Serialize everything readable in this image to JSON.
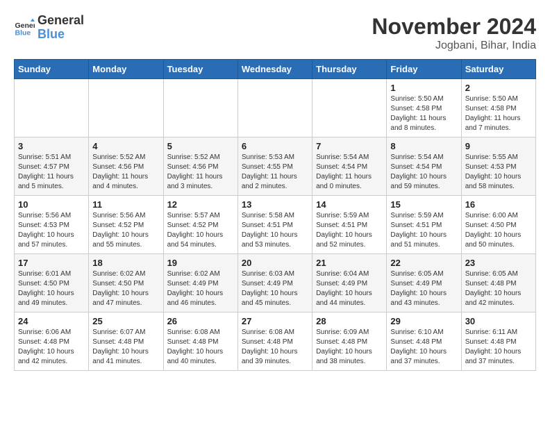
{
  "header": {
    "logo_line1": "General",
    "logo_line2": "Blue",
    "month": "November 2024",
    "location": "Jogbani, Bihar, India"
  },
  "weekdays": [
    "Sunday",
    "Monday",
    "Tuesday",
    "Wednesday",
    "Thursday",
    "Friday",
    "Saturday"
  ],
  "weeks": [
    [
      {
        "day": "",
        "info": ""
      },
      {
        "day": "",
        "info": ""
      },
      {
        "day": "",
        "info": ""
      },
      {
        "day": "",
        "info": ""
      },
      {
        "day": "",
        "info": ""
      },
      {
        "day": "1",
        "info": "Sunrise: 5:50 AM\nSunset: 4:58 PM\nDaylight: 11 hours\nand 8 minutes."
      },
      {
        "day": "2",
        "info": "Sunrise: 5:50 AM\nSunset: 4:58 PM\nDaylight: 11 hours\nand 7 minutes."
      }
    ],
    [
      {
        "day": "3",
        "info": "Sunrise: 5:51 AM\nSunset: 4:57 PM\nDaylight: 11 hours\nand 5 minutes."
      },
      {
        "day": "4",
        "info": "Sunrise: 5:52 AM\nSunset: 4:56 PM\nDaylight: 11 hours\nand 4 minutes."
      },
      {
        "day": "5",
        "info": "Sunrise: 5:52 AM\nSunset: 4:56 PM\nDaylight: 11 hours\nand 3 minutes."
      },
      {
        "day": "6",
        "info": "Sunrise: 5:53 AM\nSunset: 4:55 PM\nDaylight: 11 hours\nand 2 minutes."
      },
      {
        "day": "7",
        "info": "Sunrise: 5:54 AM\nSunset: 4:54 PM\nDaylight: 11 hours\nand 0 minutes."
      },
      {
        "day": "8",
        "info": "Sunrise: 5:54 AM\nSunset: 4:54 PM\nDaylight: 10 hours\nand 59 minutes."
      },
      {
        "day": "9",
        "info": "Sunrise: 5:55 AM\nSunset: 4:53 PM\nDaylight: 10 hours\nand 58 minutes."
      }
    ],
    [
      {
        "day": "10",
        "info": "Sunrise: 5:56 AM\nSunset: 4:53 PM\nDaylight: 10 hours\nand 57 minutes."
      },
      {
        "day": "11",
        "info": "Sunrise: 5:56 AM\nSunset: 4:52 PM\nDaylight: 10 hours\nand 55 minutes."
      },
      {
        "day": "12",
        "info": "Sunrise: 5:57 AM\nSunset: 4:52 PM\nDaylight: 10 hours\nand 54 minutes."
      },
      {
        "day": "13",
        "info": "Sunrise: 5:58 AM\nSunset: 4:51 PM\nDaylight: 10 hours\nand 53 minutes."
      },
      {
        "day": "14",
        "info": "Sunrise: 5:59 AM\nSunset: 4:51 PM\nDaylight: 10 hours\nand 52 minutes."
      },
      {
        "day": "15",
        "info": "Sunrise: 5:59 AM\nSunset: 4:51 PM\nDaylight: 10 hours\nand 51 minutes."
      },
      {
        "day": "16",
        "info": "Sunrise: 6:00 AM\nSunset: 4:50 PM\nDaylight: 10 hours\nand 50 minutes."
      }
    ],
    [
      {
        "day": "17",
        "info": "Sunrise: 6:01 AM\nSunset: 4:50 PM\nDaylight: 10 hours\nand 49 minutes."
      },
      {
        "day": "18",
        "info": "Sunrise: 6:02 AM\nSunset: 4:50 PM\nDaylight: 10 hours\nand 47 minutes."
      },
      {
        "day": "19",
        "info": "Sunrise: 6:02 AM\nSunset: 4:49 PM\nDaylight: 10 hours\nand 46 minutes."
      },
      {
        "day": "20",
        "info": "Sunrise: 6:03 AM\nSunset: 4:49 PM\nDaylight: 10 hours\nand 45 minutes."
      },
      {
        "day": "21",
        "info": "Sunrise: 6:04 AM\nSunset: 4:49 PM\nDaylight: 10 hours\nand 44 minutes."
      },
      {
        "day": "22",
        "info": "Sunrise: 6:05 AM\nSunset: 4:49 PM\nDaylight: 10 hours\nand 43 minutes."
      },
      {
        "day": "23",
        "info": "Sunrise: 6:05 AM\nSunset: 4:48 PM\nDaylight: 10 hours\nand 42 minutes."
      }
    ],
    [
      {
        "day": "24",
        "info": "Sunrise: 6:06 AM\nSunset: 4:48 PM\nDaylight: 10 hours\nand 42 minutes."
      },
      {
        "day": "25",
        "info": "Sunrise: 6:07 AM\nSunset: 4:48 PM\nDaylight: 10 hours\nand 41 minutes."
      },
      {
        "day": "26",
        "info": "Sunrise: 6:08 AM\nSunset: 4:48 PM\nDaylight: 10 hours\nand 40 minutes."
      },
      {
        "day": "27",
        "info": "Sunrise: 6:08 AM\nSunset: 4:48 PM\nDaylight: 10 hours\nand 39 minutes."
      },
      {
        "day": "28",
        "info": "Sunrise: 6:09 AM\nSunset: 4:48 PM\nDaylight: 10 hours\nand 38 minutes."
      },
      {
        "day": "29",
        "info": "Sunrise: 6:10 AM\nSunset: 4:48 PM\nDaylight: 10 hours\nand 37 minutes."
      },
      {
        "day": "30",
        "info": "Sunrise: 6:11 AM\nSunset: 4:48 PM\nDaylight: 10 hours\nand 37 minutes."
      }
    ]
  ]
}
